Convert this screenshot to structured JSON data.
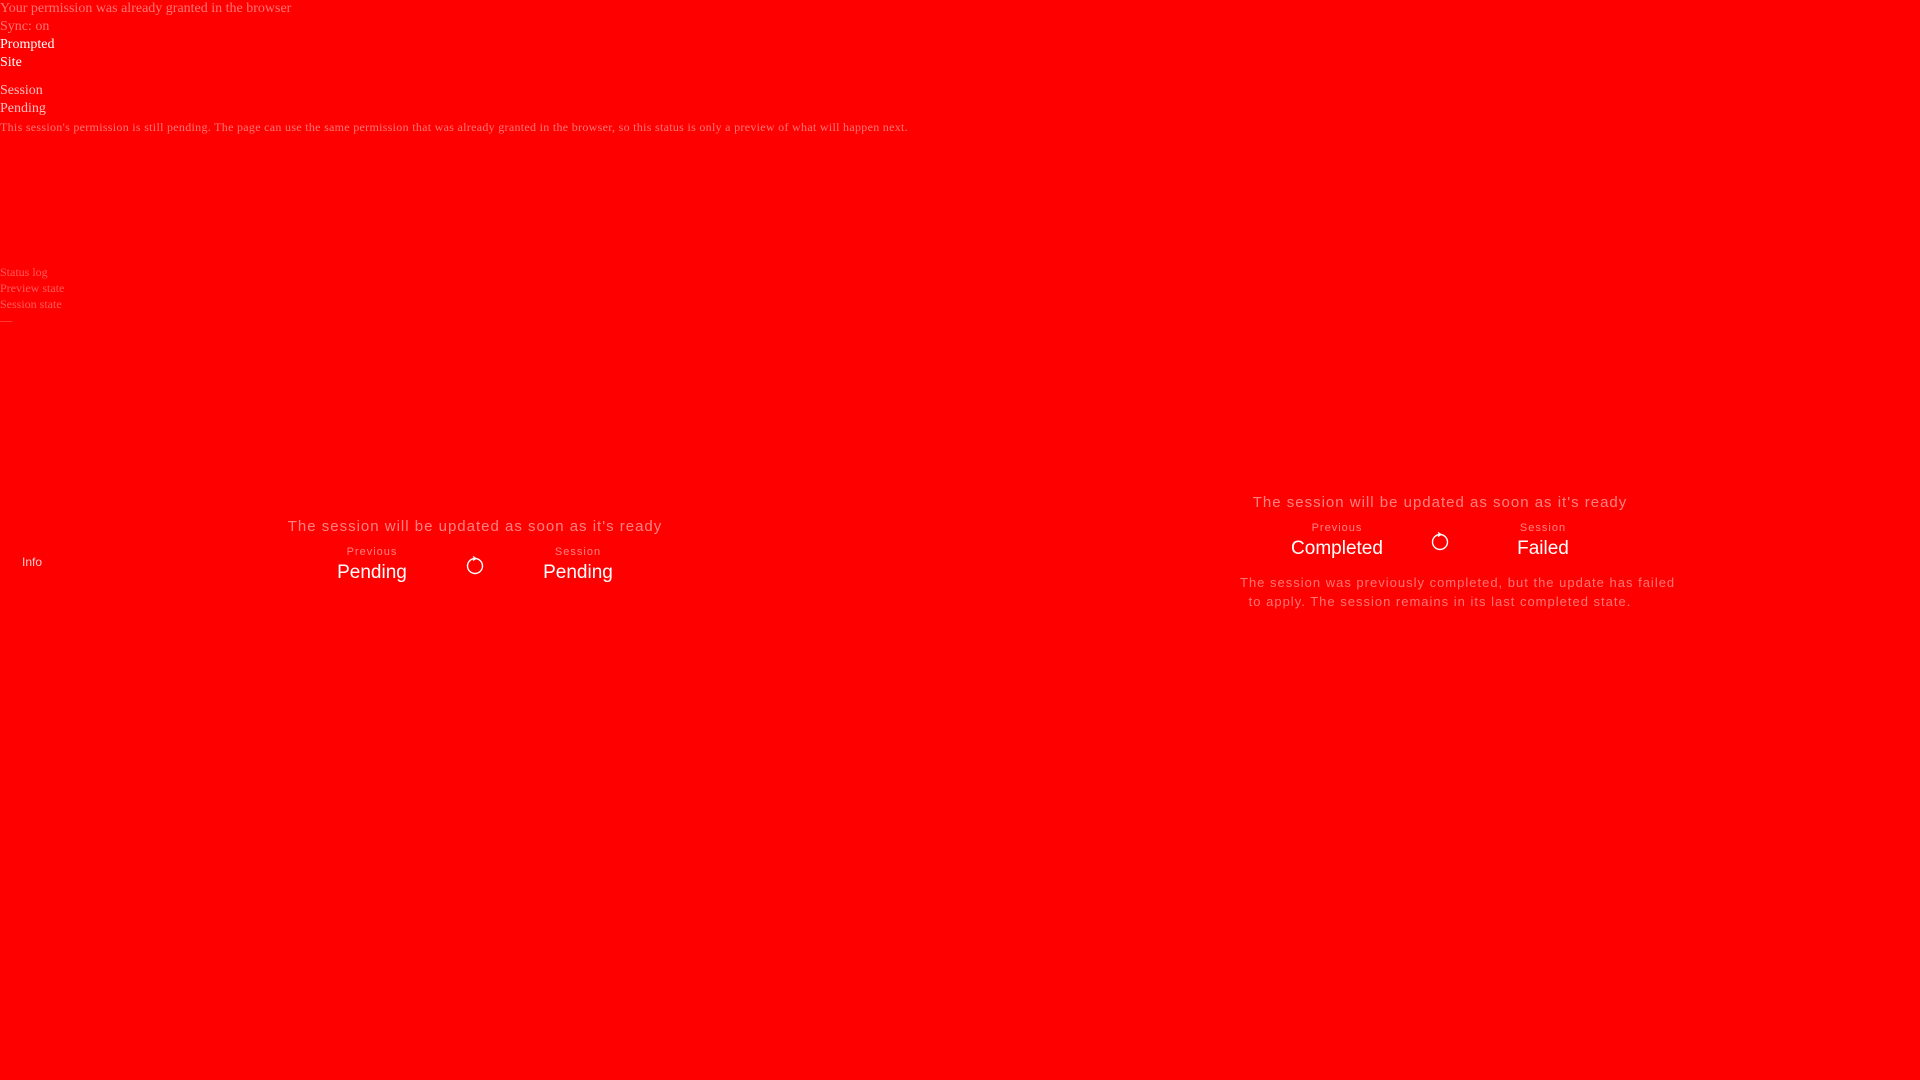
{
  "debug": {
    "line1": "Your permission was already granted in the browser",
    "line2": "Sync: on",
    "line3": "Prompted",
    "line4": "Site",
    "line5": "Session",
    "line6": "Pending",
    "line7": "This session's permission is still pending. The page can use the same permission that was already granted in the browser, so this status is only a preview of what will happen next.",
    "mid1": "Status log",
    "mid2": "Preview state",
    "mid3": "Session state",
    "mid4": "—"
  },
  "side_label": "Info",
  "cards": {
    "left": {
      "caption": "The session will be updated as soon as it's ready",
      "prev_label": "Previous",
      "prev_value": "Pending",
      "curr_label": "Session",
      "curr_value": "Pending",
      "icon": "refresh-icon"
    },
    "right": {
      "caption": "The session will be updated as soon as it's ready",
      "prev_label": "Previous",
      "prev_value": "Completed",
      "curr_label": "Session",
      "curr_value": "Failed",
      "icon": "refresh-icon",
      "note1": "The session was previously completed, but the update has failed",
      "note2": "to apply. The session remains in its last completed state."
    }
  },
  "colors": {
    "background": "#ff0000",
    "text": "#ffffff"
  }
}
